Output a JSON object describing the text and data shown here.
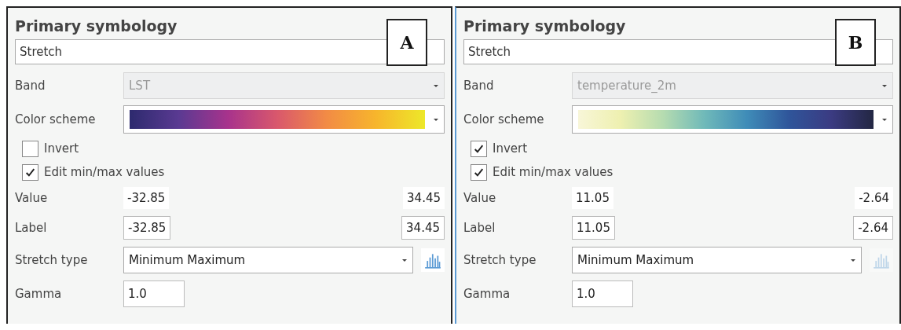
{
  "panels": [
    {
      "badge": "A",
      "heading": "Primary symbology",
      "renderer": "Stretch",
      "band": {
        "label": "Band",
        "value": "LST",
        "disabled": true
      },
      "color_scheme": {
        "label": "Color scheme",
        "kind": "plasma"
      },
      "invert": {
        "label": "Invert",
        "checked": false
      },
      "edit_minmax": {
        "label": "Edit min/max values",
        "checked": true
      },
      "value": {
        "label": "Value",
        "min": "-32.85",
        "max": "34.45"
      },
      "label_row": {
        "label": "Label",
        "min": "-32.85",
        "max": "34.45"
      },
      "stretch_type": {
        "label": "Stretch type",
        "value": "Minimum Maximum",
        "histogram_disabled": false
      },
      "gamma": {
        "label": "Gamma",
        "value": "1.0"
      }
    },
    {
      "badge": "B",
      "heading": "Primary symbology",
      "renderer": "Stretch",
      "band": {
        "label": "Band",
        "value": "temperature_2m",
        "disabled": true
      },
      "color_scheme": {
        "label": "Color scheme",
        "kind": "ylgnbu"
      },
      "invert": {
        "label": "Invert",
        "checked": true
      },
      "edit_minmax": {
        "label": "Edit min/max values",
        "checked": true
      },
      "value": {
        "label": "Value",
        "min": "11.05",
        "max": "-2.64"
      },
      "label_row": {
        "label": "Label",
        "min": "11.05",
        "max": "-2.64"
      },
      "stretch_type": {
        "label": "Stretch type",
        "value": "Minimum Maximum",
        "histogram_disabled": true
      },
      "gamma": {
        "label": "Gamma",
        "value": "1.0"
      }
    }
  ]
}
